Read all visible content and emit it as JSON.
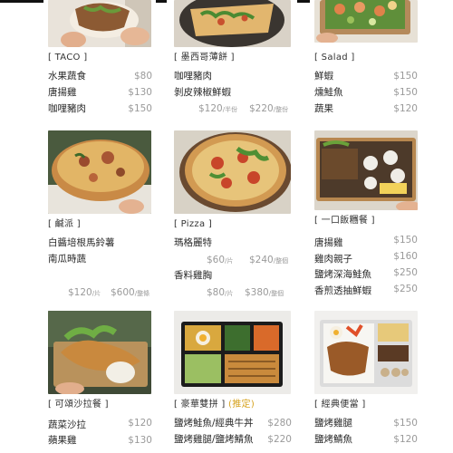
{
  "sections": [
    {
      "title": "[ TACO ]",
      "photo_icon": "taco-wrap-photo",
      "items": [
        {
          "name": "水果蔬食",
          "price": "$80"
        },
        {
          "name": "唐揚雞",
          "price": "$130"
        },
        {
          "name": "咖哩豬肉",
          "price": "$150"
        }
      ]
    },
    {
      "title": "[ 墨西哥薄餅 ]",
      "photo_icon": "quesadilla-photo",
      "items": [
        {
          "name": "咖哩豬肉"
        },
        {
          "name": "剝皮辣椒鮮蝦"
        }
      ],
      "prices": [
        {
          "price": "$120",
          "unit": "/半份"
        },
        {
          "price": "$220",
          "unit": "/整份"
        }
      ]
    },
    {
      "title": "[ Salad ]",
      "photo_icon": "salad-photo",
      "items": [
        {
          "name": "鮮蝦",
          "price": "$150"
        },
        {
          "name": "燻鮭魚",
          "price": "$150"
        },
        {
          "name": "蔬果",
          "price": "$120"
        }
      ]
    },
    {
      "title": "[ 鹹派 ]",
      "photo_icon": "quiche-photo",
      "items": [
        {
          "name": "白醬培根馬鈴薯"
        },
        {
          "name": "南瓜時蔬"
        }
      ],
      "prices": [
        {
          "price": "$120",
          "unit": "/片"
        },
        {
          "price": "$600",
          "unit": "/整條"
        }
      ]
    },
    {
      "title": "[ Pizza ]",
      "photo_icon": "pizza-photo",
      "items": [
        {
          "name": "瑪格麗特",
          "p1": "$60",
          "u1": "/片",
          "p2": "$240",
          "u2": "/整個"
        },
        {
          "name": "香料雞胸",
          "p1": "$80",
          "u1": "/片",
          "p2": "$380",
          "u2": "/整個"
        }
      ]
    },
    {
      "title": "[ 一口飯糰餐 ]",
      "photo_icon": "rice-ball-box-photo",
      "items": [
        {
          "name": "唐揚雞",
          "price": "$150"
        },
        {
          "name": "雞肉親子",
          "price": "$160"
        },
        {
          "name": "鹽烤深海鮭魚",
          "price": "$250"
        },
        {
          "name": "香煎透抽鮮蝦",
          "price": "$250"
        }
      ]
    },
    {
      "title": "[ 可頌沙拉餐 ]",
      "photo_icon": "croissant-salad-photo",
      "items": [
        {
          "name": "蔬菜沙拉",
          "price": "$120"
        },
        {
          "name": "蘋果雞",
          "price": "$130"
        }
      ]
    },
    {
      "title": "[ 豪華雙拼 ]",
      "title_note": "(推定)",
      "photo_icon": "bento-deluxe-photo",
      "items": [
        {
          "name": "鹽烤鮭魚/經典牛丼",
          "price": "$280"
        },
        {
          "name": "鹽烤雞腿/鹽烤鯖魚",
          "price": "$220"
        }
      ]
    },
    {
      "title": "[ 經典便當 ]",
      "photo_icon": "bento-classic-photo",
      "items": [
        {
          "name": "鹽烤雞腿",
          "price": "$150"
        },
        {
          "name": "鹽烤鯖魚",
          "price": "$120"
        }
      ]
    }
  ]
}
